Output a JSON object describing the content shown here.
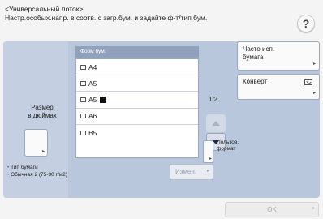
{
  "header": {
    "line1": "<Универсальный лоток>",
    "line2": "Настр.особых.напр. в соотв. с загр.бум. и задайте ф-т/тип бум."
  },
  "help_label": "?",
  "size_button": {
    "label_line1": "Размер",
    "label_line2": "в дюймах"
  },
  "list": {
    "header": "Форм бум.",
    "items": [
      "A4",
      "A5",
      "A5R",
      "A6",
      "B5"
    ],
    "selected": "A5R"
  },
  "pagination": "1/2",
  "right_buttons": {
    "frequent_line1": "Часто исп.",
    "frequent_line2": "бумага",
    "envelope": "Конверт"
  },
  "custom_format": {
    "line1": "Пользов.",
    "line2": "формат"
  },
  "paper_type": {
    "label": "Тип бумаги",
    "value": "Обычная 2 (75-90 г/м2)"
  },
  "change_button": "Измен.",
  "ok_button": "OK",
  "colors": {
    "panel": "#b9c7dc",
    "list_header": "#8fa1bd",
    "accent_dot": "#3a6fc4"
  }
}
